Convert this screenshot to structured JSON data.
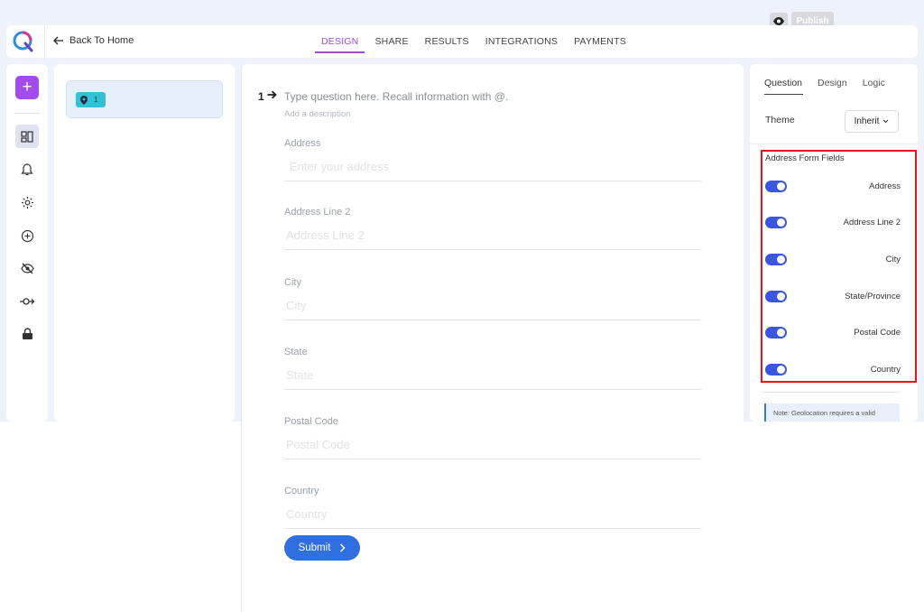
{
  "top_actions": {
    "publish_label": "Publish",
    "preview_icon": "eye-icon"
  },
  "header": {
    "back_label": "Back To Home",
    "tabs": [
      {
        "label": "DESIGN",
        "active": true
      },
      {
        "label": "SHARE",
        "active": false
      },
      {
        "label": "RESULTS",
        "active": false
      },
      {
        "label": "INTEGRATIONS",
        "active": false
      },
      {
        "label": "PAYMENTS",
        "active": false
      }
    ]
  },
  "sidebar": {
    "add_label": "+",
    "icons": [
      "layout-icon",
      "bell-icon",
      "gear-icon",
      "compass-icon",
      "eye-slash-icon",
      "logic-arrow-icon",
      "lock-icon"
    ]
  },
  "question_list": {
    "items": [
      {
        "number": "1",
        "icon": "location-pin-icon"
      }
    ]
  },
  "question": {
    "number": "1",
    "title_placeholder": "Type question here. Recall information with @.",
    "description_placeholder": "Add a description",
    "fields": [
      {
        "label": "Address",
        "placeholder": "Enter your address"
      },
      {
        "label": "Address Line 2",
        "placeholder": "Address Line 2"
      },
      {
        "label": "City",
        "placeholder": "City"
      },
      {
        "label": "State",
        "placeholder": "State"
      },
      {
        "label": "Postal Code",
        "placeholder": "Postal Code"
      },
      {
        "label": "Country",
        "placeholder": "Country"
      }
    ],
    "submit_label": "Submit"
  },
  "settings": {
    "tabs": [
      {
        "label": "Question",
        "active": true
      },
      {
        "label": "Design",
        "active": false
      },
      {
        "label": "Logic",
        "active": false
      }
    ],
    "theme_label": "Theme",
    "theme_value": "Inherit",
    "address_fields_title": "Address Form Fields",
    "address_fields": [
      {
        "label": "Address",
        "enabled": true
      },
      {
        "label": "Address Line 2",
        "enabled": true
      },
      {
        "label": "City",
        "enabled": true
      },
      {
        "label": "State/Province",
        "enabled": true
      },
      {
        "label": "Postal Code",
        "enabled": true
      },
      {
        "label": "Country",
        "enabled": true
      }
    ],
    "note": "Note: Geolocation requires a valid"
  },
  "colors": {
    "accent": "#a14bd9",
    "primary": "#2f6fe0",
    "toggle": "#3856e0",
    "highlight": "#e8141b"
  }
}
